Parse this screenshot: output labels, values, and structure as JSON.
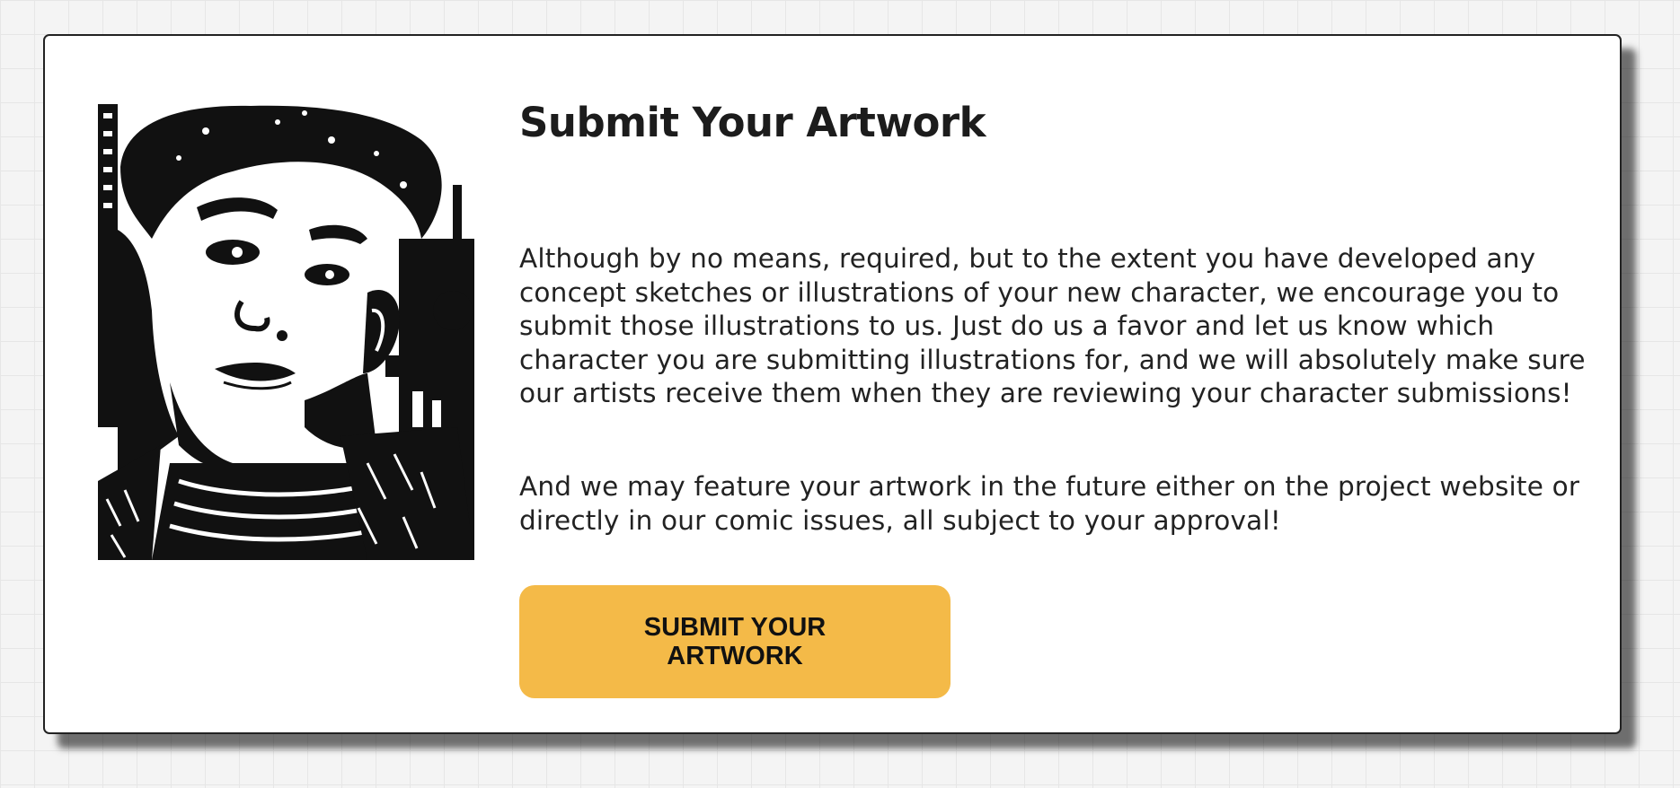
{
  "card": {
    "title": "Submit Your Artwork",
    "paragraphs": [
      "Although by no means, required, but to the extent you have developed any concept sketches or illustrations of your new character, we encourage you to submit those illustrations to us.  Just do us a favor and let us know which character you are submitting illustrations for, and we will absolutely make sure our artists receive them when they are reviewing your character submissions!",
      "And we may feature your artwork in the future either on the project website or directly in our comic issues, all subject to your approval!"
    ],
    "button_label": "SUBMIT YOUR ARTWORK",
    "image_icon": "comic-portrait-illustration"
  },
  "colors": {
    "button_bg": "#f4ba48",
    "card_bg": "#ffffff",
    "page_bg": "#f4f4f4",
    "text": "#222222"
  }
}
